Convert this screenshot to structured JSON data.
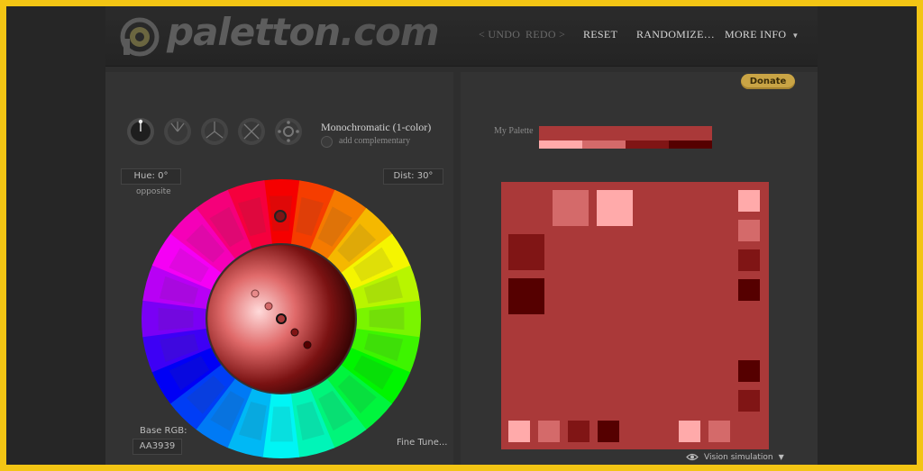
{
  "header": {
    "logo_text": "paletton",
    "logo_suffix": ".com",
    "nav": {
      "undo": "< UNDO",
      "redo": "REDO >",
      "reset": "RESET",
      "randomize": "RANDOMIZE…",
      "more_info": "MORE INFO"
    }
  },
  "donate_label": "Donate",
  "controls": {
    "modes": [
      "monochromatic-icon",
      "adjacent-icon",
      "triad-icon",
      "tetrad-icon",
      "freestyle-icon"
    ],
    "mode_label": "Monochromatic (1-color)",
    "complement_label": "add complementary",
    "hue_label": "Hue: 0°",
    "dist_label": "Dist: 30°",
    "opposite_label": "opposite",
    "base_rgb_label": "Base RGB:",
    "base_rgb_value": "AA3939",
    "fine_tune_label": "Fine Tune..."
  },
  "palette": {
    "label": "My Palette",
    "base_color": "#AA3939",
    "shades": [
      "#FFAAAA",
      "#D46A6A",
      "#801515",
      "#550000"
    ]
  },
  "vision_label": "Vision simulation"
}
